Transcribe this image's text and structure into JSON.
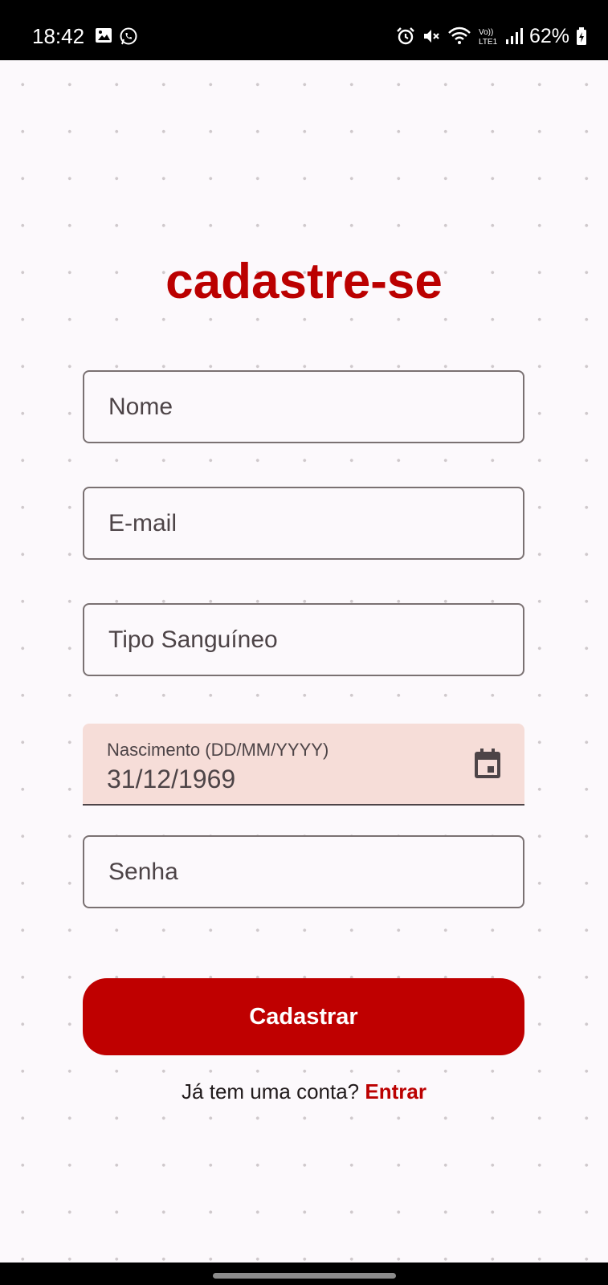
{
  "status_bar": {
    "time": "18:42",
    "battery": "62%",
    "icons": [
      "gallery-icon",
      "whatsapp-icon",
      "alarm-icon",
      "mute-icon",
      "wifi-icon",
      "volte-icon",
      "signal-icon",
      "battery-icon"
    ]
  },
  "form": {
    "title": "cadastre-se",
    "fields": {
      "name": {
        "placeholder": "Nome"
      },
      "email": {
        "placeholder": "E-mail"
      },
      "blood_type": {
        "placeholder": "Tipo Sanguíneo"
      },
      "birth_date": {
        "label": "Nascimento (DD/MM/YYYY)",
        "value": "31/12/1969"
      },
      "password": {
        "placeholder": "Senha"
      }
    },
    "submit_label": "Cadastrar",
    "login_prompt": "Já tem uma conta?",
    "login_link": "Entrar"
  },
  "colors": {
    "accent": "#bf0000",
    "background": "#fcf9fc",
    "filled_field": "#f6ddd8"
  }
}
